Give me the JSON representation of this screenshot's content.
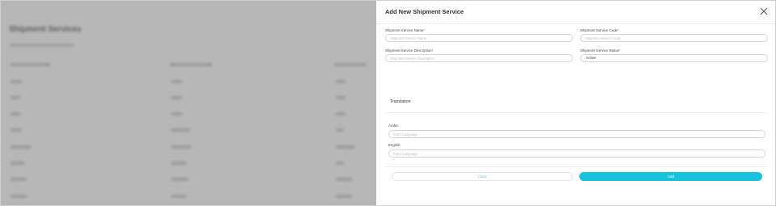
{
  "background": {
    "page_title": "Shipment Services"
  },
  "modal": {
    "title": "Add New Shipment Service",
    "fields": {
      "name": {
        "label": "Shipment Service Name",
        "required_mark": "*",
        "placeholder": "Shipment Service Name",
        "value": ""
      },
      "code": {
        "label": "Shipment Service Code",
        "required_mark": "*",
        "placeholder": "Shipment Service Code",
        "value": ""
      },
      "description": {
        "label": "Shipment Service Description",
        "required_mark": "*",
        "placeholder": "Shipment Service Description",
        "value": ""
      },
      "status": {
        "label": "Shipment Service Status",
        "required_mark": "*",
        "value": "Active"
      }
    },
    "translation": {
      "title": "Translation",
      "languages": [
        {
          "label": "Arabic",
          "placeholder": "Enter Language",
          "value": ""
        },
        {
          "label": "English",
          "placeholder": "Enter Language",
          "value": ""
        }
      ]
    },
    "buttons": {
      "clear": "Clear",
      "add": "Add"
    }
  }
}
